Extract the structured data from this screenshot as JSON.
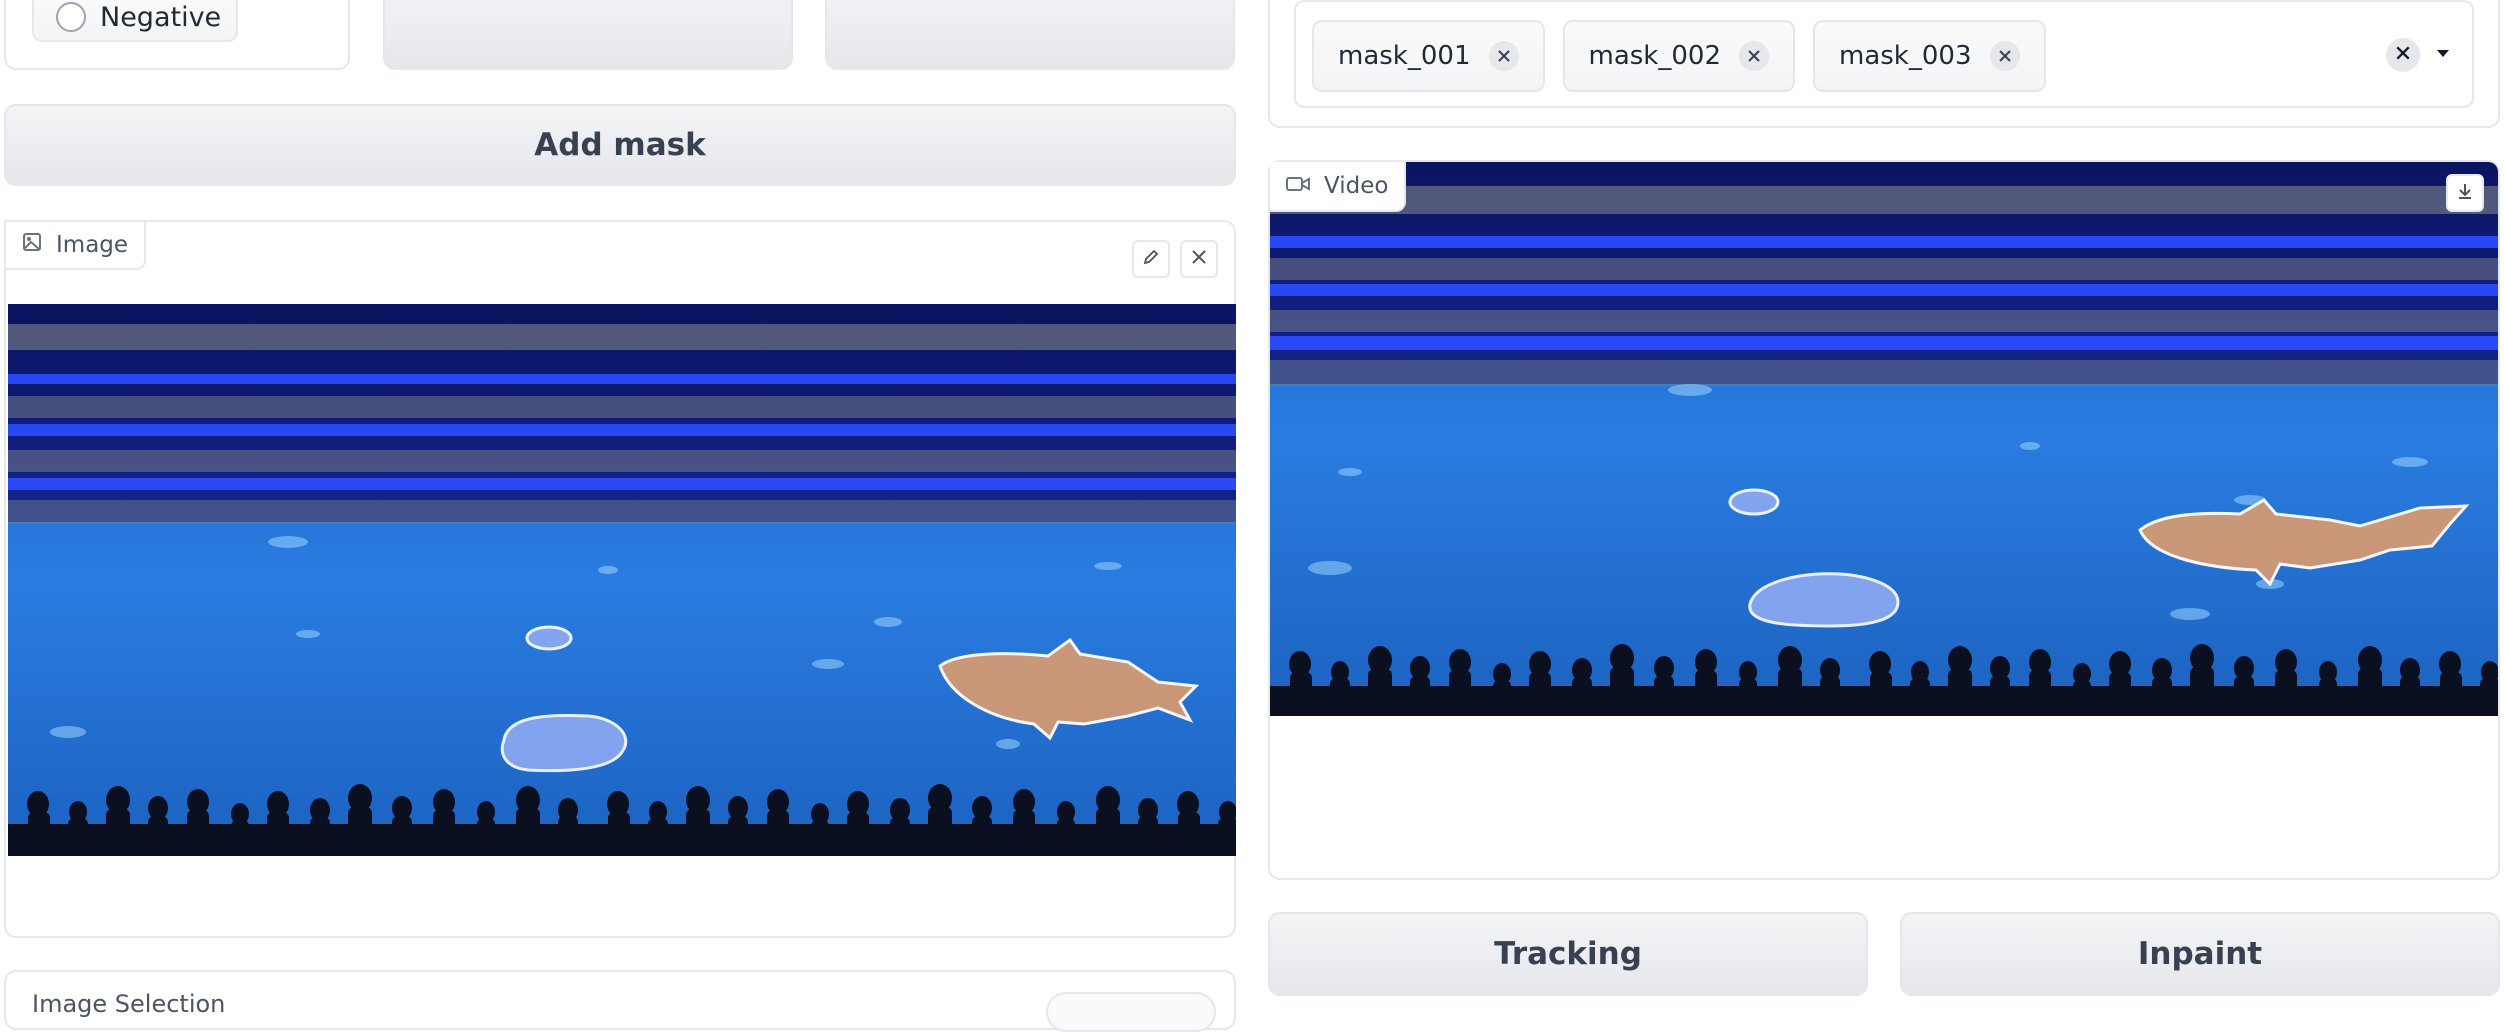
{
  "prompt_type": {
    "negative_label": "Negative"
  },
  "actions": {
    "add_mask_label": "Add mask"
  },
  "image_component": {
    "label": "Image",
    "label_icon": "image-icon",
    "edit_icon": "pencil-icon",
    "close_icon": "close-icon"
  },
  "mask_dropdown": {
    "selected": [
      {
        "label": "mask_001"
      },
      {
        "label": "mask_002"
      },
      {
        "label": "mask_003"
      }
    ],
    "clear_icon": "close-icon",
    "toggle_icon": "caret-down-icon"
  },
  "video_component": {
    "label": "Video",
    "label_icon": "video-camera-icon",
    "download_icon": "download-icon"
  },
  "buttons": {
    "tracking_label": "Tracking",
    "inpaint_label": "Inpaint"
  },
  "bottom_panel": {
    "partial_title": "Image Selection"
  },
  "colors": {
    "mask_blue": "#8da9f2",
    "mask_orange": "#d29a74",
    "accent_border": "#e5e7eb"
  }
}
